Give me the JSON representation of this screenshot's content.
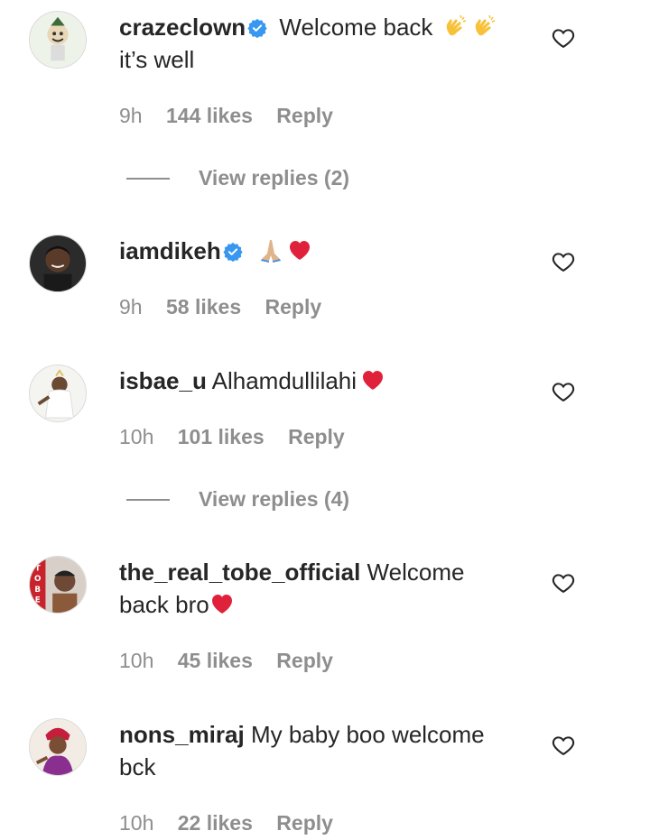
{
  "comments": [
    {
      "username": "crazeclown",
      "verified": true,
      "text": "Welcome back",
      "emojis": [
        "clapping-hands",
        "clapping-hands"
      ],
      "text2": "it’s well",
      "time": "9h",
      "likes": "144 likes",
      "reply": "Reply",
      "replies_label": "View replies (2)"
    },
    {
      "username": "iamdikeh",
      "verified": true,
      "text": "",
      "emojis": [
        "folded-hands",
        "red-heart"
      ],
      "time": "9h",
      "likes": "58 likes",
      "reply": "Reply"
    },
    {
      "username": "isbae_u",
      "verified": false,
      "text": "Alhamdullilahi",
      "emojis": [
        "red-heart"
      ],
      "time": "10h",
      "likes": "101 likes",
      "reply": "Reply",
      "replies_label": "View replies (4)"
    },
    {
      "username": "the_real_tobe_official",
      "verified": false,
      "text": "Welcome",
      "text2": "back bro",
      "emojis2": [
        "red-heart"
      ],
      "time": "10h",
      "likes": "45 likes",
      "reply": "Reply"
    },
    {
      "username": "nons_miraj",
      "verified": false,
      "text": "My baby boo welcome",
      "text2": "bck",
      "time": "10h",
      "likes": "22 likes",
      "reply": "Reply"
    }
  ],
  "colors": {
    "text": "#262626",
    "meta": "#8e8e8e",
    "verified": "#3897f0",
    "heart": "#e0245e"
  },
  "icons": {
    "like": "heart-outline-icon",
    "verified": "verified-badge-icon"
  }
}
